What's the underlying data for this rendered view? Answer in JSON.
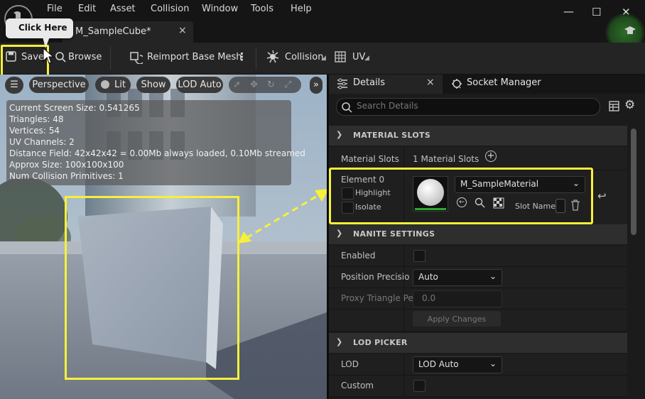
{
  "menu": [
    "File",
    "Edit",
    "Asset",
    "Collision",
    "Window",
    "Tools",
    "Help"
  ],
  "document_tab": {
    "label": "M_SampleCube*",
    "close": "×"
  },
  "window": {
    "minimize": "—",
    "maximize": "☐",
    "close": "✕"
  },
  "callout": {
    "label": "Click Here"
  },
  "toolbar": {
    "save": "Save",
    "browse": "Browse",
    "reimport": "Reimport Base Mesh",
    "collision": "Collision",
    "uv": "UV"
  },
  "viewport": {
    "perspective": "Perspective",
    "lit": "Lit",
    "show": "Show",
    "lod": "LOD Auto",
    "stats": [
      "Current Screen Size:  0.541265",
      "Triangles:  48",
      "Vertices:  54",
      "UV Channels:  2",
      "Distance Field:  42x42x42 = 0.00Mb always loaded, 0.10Mb streamed",
      "Approx Size: 100x100x100",
      "Num Collision Primitives:  1"
    ]
  },
  "panel": {
    "details_tab": "Details",
    "details_close": "×",
    "socket_tab": "Socket Manager",
    "search_placeholder": "Search Details"
  },
  "material_slots": {
    "header": "MATERIAL SLOTS",
    "row_label": "Material Slots",
    "count": "1 Material Slots",
    "element": "Element 0",
    "highlight": "Highlight",
    "isolate": "Isolate",
    "material": "M_SampleMaterial",
    "slot_name": "Slot Name"
  },
  "nanite": {
    "header": "NANITE SETTINGS",
    "enabled": "Enabled",
    "position_precision": "Position Precisio",
    "position_value": "Auto",
    "proxy": "Proxy Triangle Pe",
    "proxy_value": "0.0",
    "apply": "Apply Changes"
  },
  "lod_picker": {
    "header": "LOD PICKER",
    "lod": "LOD",
    "lod_value": "LOD Auto",
    "custom": "Custom"
  }
}
